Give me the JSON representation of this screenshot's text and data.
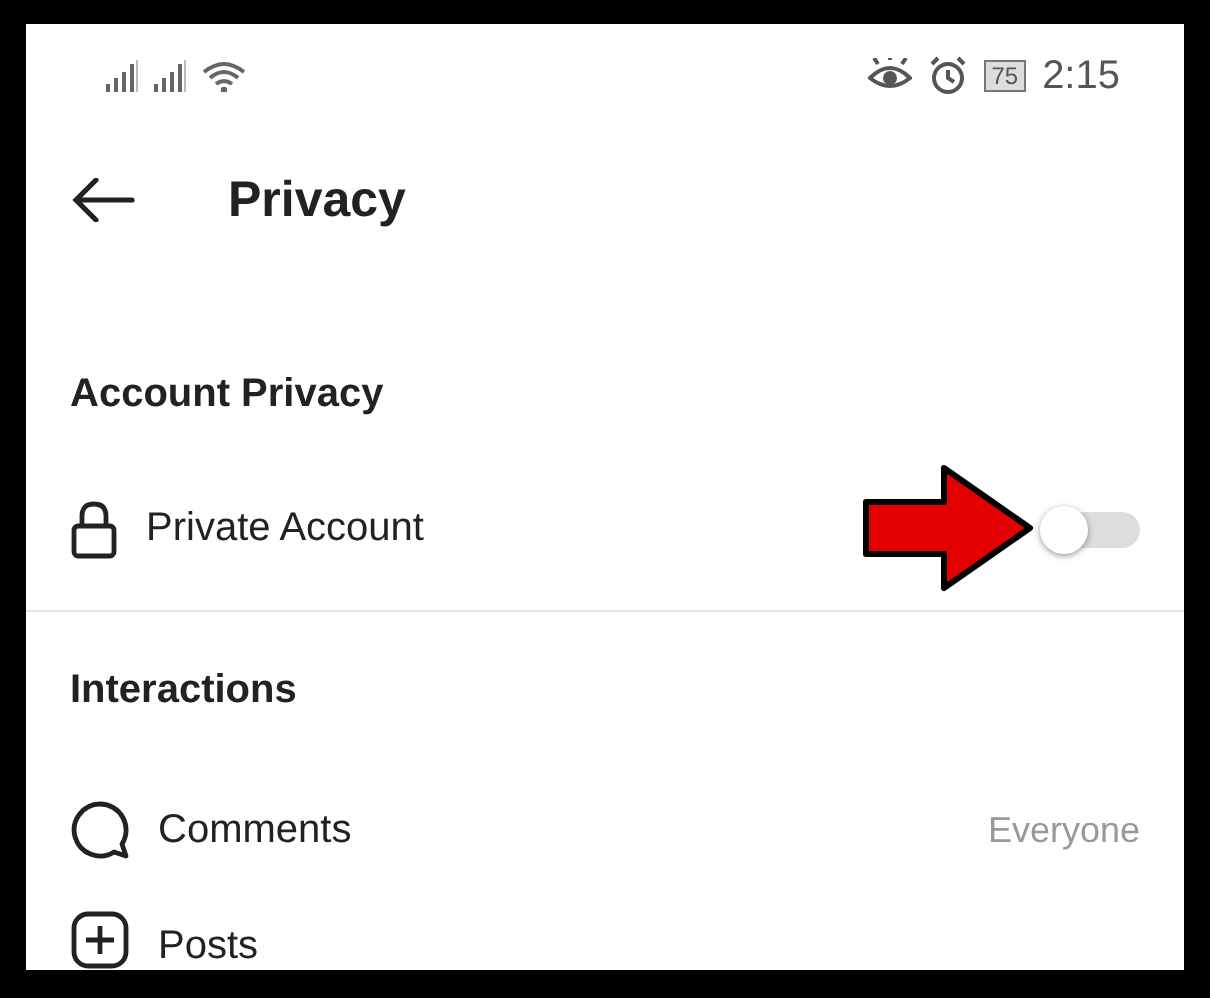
{
  "status_bar": {
    "battery": "75",
    "time": "2:15"
  },
  "header": {
    "title": "Privacy"
  },
  "sections": [
    {
      "title": "Account Privacy",
      "items": [
        {
          "kind": "toggle",
          "label": "Private Account",
          "on": false
        }
      ]
    },
    {
      "title": "Interactions",
      "items": [
        {
          "kind": "link",
          "label": "Comments",
          "value": "Everyone"
        },
        {
          "kind": "link",
          "label": "Posts"
        }
      ]
    }
  ]
}
